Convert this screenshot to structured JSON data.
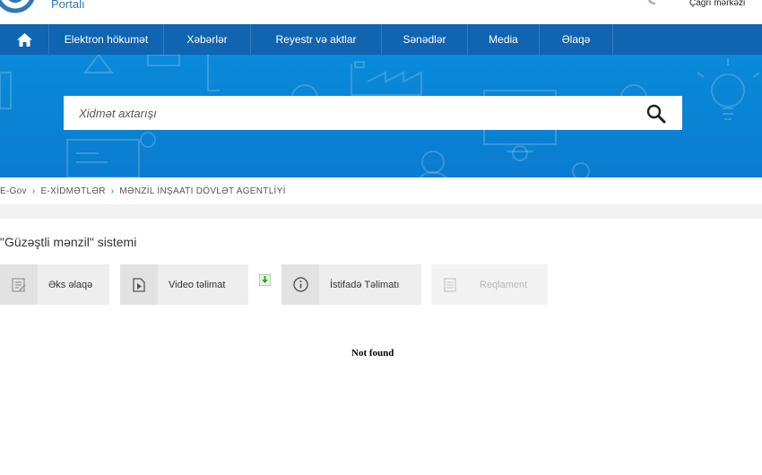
{
  "header": {
    "portal_text": "Portalı",
    "call_center": "Çağrı mərkəzi"
  },
  "nav": {
    "items": [
      {
        "label": "Elektron hökumət"
      },
      {
        "label": "Xəbərlər"
      },
      {
        "label": "Reyestr və aktlar"
      },
      {
        "label": "Sənədlər"
      },
      {
        "label": "Media"
      },
      {
        "label": "Əlaqə"
      }
    ]
  },
  "search": {
    "placeholder": "Xidmət axtarışı"
  },
  "breadcrumb": {
    "items": [
      "E-Gov",
      "E-XİDMƏTLƏR",
      "MƏNZİL İNŞAATI DÖVLƏT AGENTLİYİ"
    ]
  },
  "page": {
    "title": "\"Güzəştli mənzil\" sistemi"
  },
  "actions": [
    {
      "label": "Əks əlaqə",
      "icon": "feedback-icon"
    },
    {
      "label": "Video təlimat",
      "icon": "video-icon"
    },
    {
      "label": "İstifadə Təlimatı",
      "icon": "info-icon"
    },
    {
      "label": "Reqlament",
      "icon": "document-icon"
    }
  ],
  "content": {
    "message": "Not found"
  },
  "colors": {
    "nav_bg": "#1064b0",
    "hero_bg": "#0a8ad9",
    "accent": "#1a6fb8",
    "download_green": "#3aa53a"
  }
}
